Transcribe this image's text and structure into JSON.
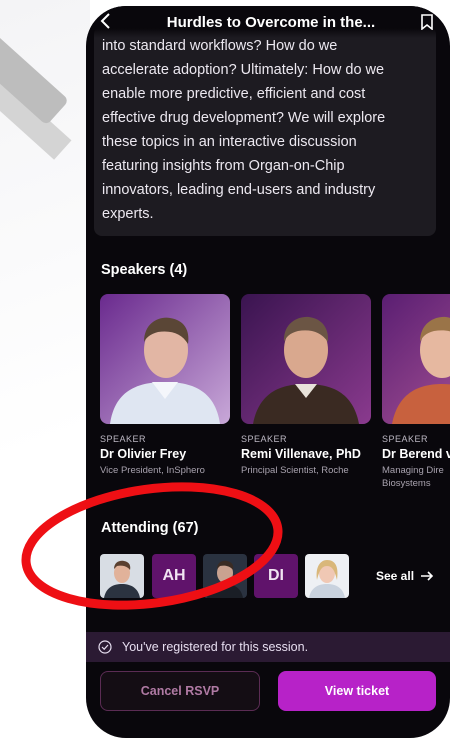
{
  "header": {
    "title": "Hurdles to Overcome in the..."
  },
  "description": {
    "lines": [
      "into standard workflows? How do we",
      "accelerate adoption? Ultimately: How do we",
      "enable more predictive, efficient and cost",
      "effective drug development? We will explore",
      "these topics in an interactive discussion",
      "featuring insights from Organ-on-Chip",
      "innovators, leading end-users and industry",
      "experts."
    ]
  },
  "speakers": {
    "title": "Speakers (4)",
    "items": [
      {
        "role": "SPEAKER",
        "name": "Dr Olivier Frey",
        "title_lines": [
          "Vice President, InSphero"
        ]
      },
      {
        "role": "SPEAKER",
        "name": "Remi Villenave, PhD",
        "title_lines": [
          "Principal Scientist, Roche"
        ]
      },
      {
        "role": "SPEAKER",
        "name": "Dr Berend v",
        "title_lines": [
          "Managing Dire",
          "Biosystems"
        ]
      }
    ]
  },
  "attending": {
    "title": "Attending (67)",
    "avatars": [
      {
        "type": "photo"
      },
      {
        "type": "initials",
        "text": "AH"
      },
      {
        "type": "photo"
      },
      {
        "type": "initials",
        "text": "DI"
      },
      {
        "type": "photo"
      }
    ],
    "see_all": "See all"
  },
  "banner": {
    "text": "You've registered for this session."
  },
  "actions": {
    "cancel_label": "Cancel RSVP",
    "view_label": "View ticket"
  },
  "colors": {
    "accent": "#b722c8",
    "initials_bg": "#60136b",
    "annotation_circle": "#ee0f14",
    "background": "#09070c"
  }
}
